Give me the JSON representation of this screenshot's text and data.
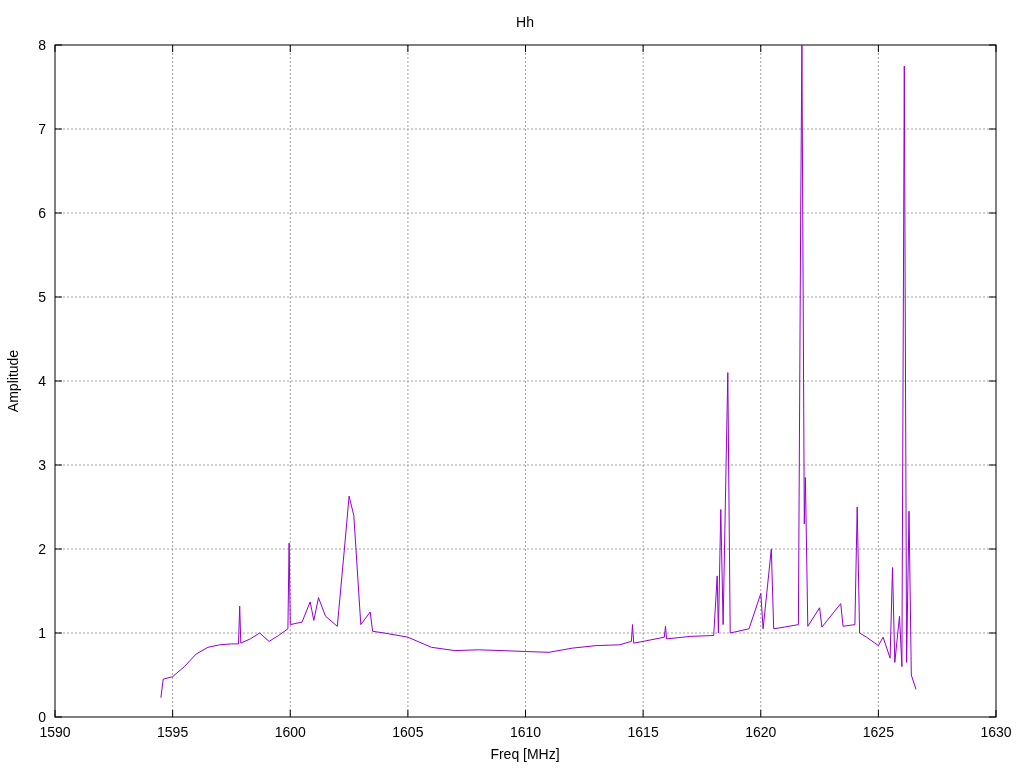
{
  "chart_data": {
    "type": "line",
    "grid": true,
    "title": "Hh",
    "xlabel": "Freq [MHz]",
    "ylabel": "Amplitude",
    "xlim": [
      1590,
      1630
    ],
    "ylim": [
      0,
      8
    ],
    "xticks": [
      1590,
      1595,
      1600,
      1605,
      1610,
      1615,
      1620,
      1625,
      1630
    ],
    "yticks": [
      0,
      1,
      2,
      3,
      4,
      5,
      6,
      7,
      8
    ],
    "x": [
      1594.5,
      1594.6,
      1595,
      1595.5,
      1596,
      1596.5,
      1597,
      1597.5,
      1597.8,
      1597.85,
      1597.9,
      1598.3,
      1598.7,
      1599.1,
      1599.5,
      1599.9,
      1599.95,
      1600,
      1600.5,
      1600.85,
      1601,
      1601.2,
      1601.5,
      1602,
      1602.3,
      1602.5,
      1602.7,
      1603,
      1603.4,
      1603.5,
      1604,
      1605,
      1606,
      1607,
      1608,
      1609,
      1610,
      1611,
      1612,
      1613,
      1614,
      1614.5,
      1614.55,
      1614.6,
      1615,
      1615.9,
      1615.95,
      1616,
      1617,
      1618,
      1618.15,
      1618.2,
      1618.3,
      1618.4,
      1618.6,
      1618.7,
      1619.5,
      1620,
      1620.1,
      1620.45,
      1620.55,
      1621,
      1621.6,
      1621.7,
      1621.75,
      1621.85,
      1621.9,
      1622,
      1622.5,
      1622.6,
      1623.4,
      1623.5,
      1624,
      1624.1,
      1624.2,
      1624.5,
      1625,
      1625.2,
      1625.5,
      1625.6,
      1625.7,
      1625.9,
      1626,
      1626.1,
      1626.2,
      1626.3,
      1626.4,
      1626.6
    ],
    "series": [
      {
        "color": "#9400d3",
        "values": [
          0.23,
          0.45,
          0.48,
          0.6,
          0.75,
          0.83,
          0.86,
          0.87,
          0.87,
          1.32,
          0.88,
          0.93,
          1.0,
          0.9,
          0.97,
          1.05,
          2.07,
          1.1,
          1.13,
          1.37,
          1.15,
          1.42,
          1.2,
          1.08,
          2.0,
          2.63,
          2.4,
          1.1,
          1.25,
          1.02,
          1.0,
          0.95,
          0.83,
          0.79,
          0.8,
          0.79,
          0.78,
          0.77,
          0.82,
          0.85,
          0.86,
          0.9,
          1.1,
          0.88,
          0.9,
          0.95,
          1.08,
          0.93,
          0.96,
          0.97,
          1.68,
          1.0,
          2.47,
          1.1,
          4.1,
          1.0,
          1.05,
          1.47,
          1.05,
          2.0,
          1.05,
          1.07,
          1.1,
          6.0,
          8.0,
          2.3,
          2.85,
          1.08,
          1.3,
          1.07,
          1.35,
          1.08,
          1.1,
          2.5,
          1.0,
          0.95,
          0.85,
          0.95,
          0.7,
          1.78,
          0.65,
          1.2,
          0.6,
          7.75,
          0.65,
          2.45,
          0.5,
          0.33
        ]
      }
    ]
  }
}
